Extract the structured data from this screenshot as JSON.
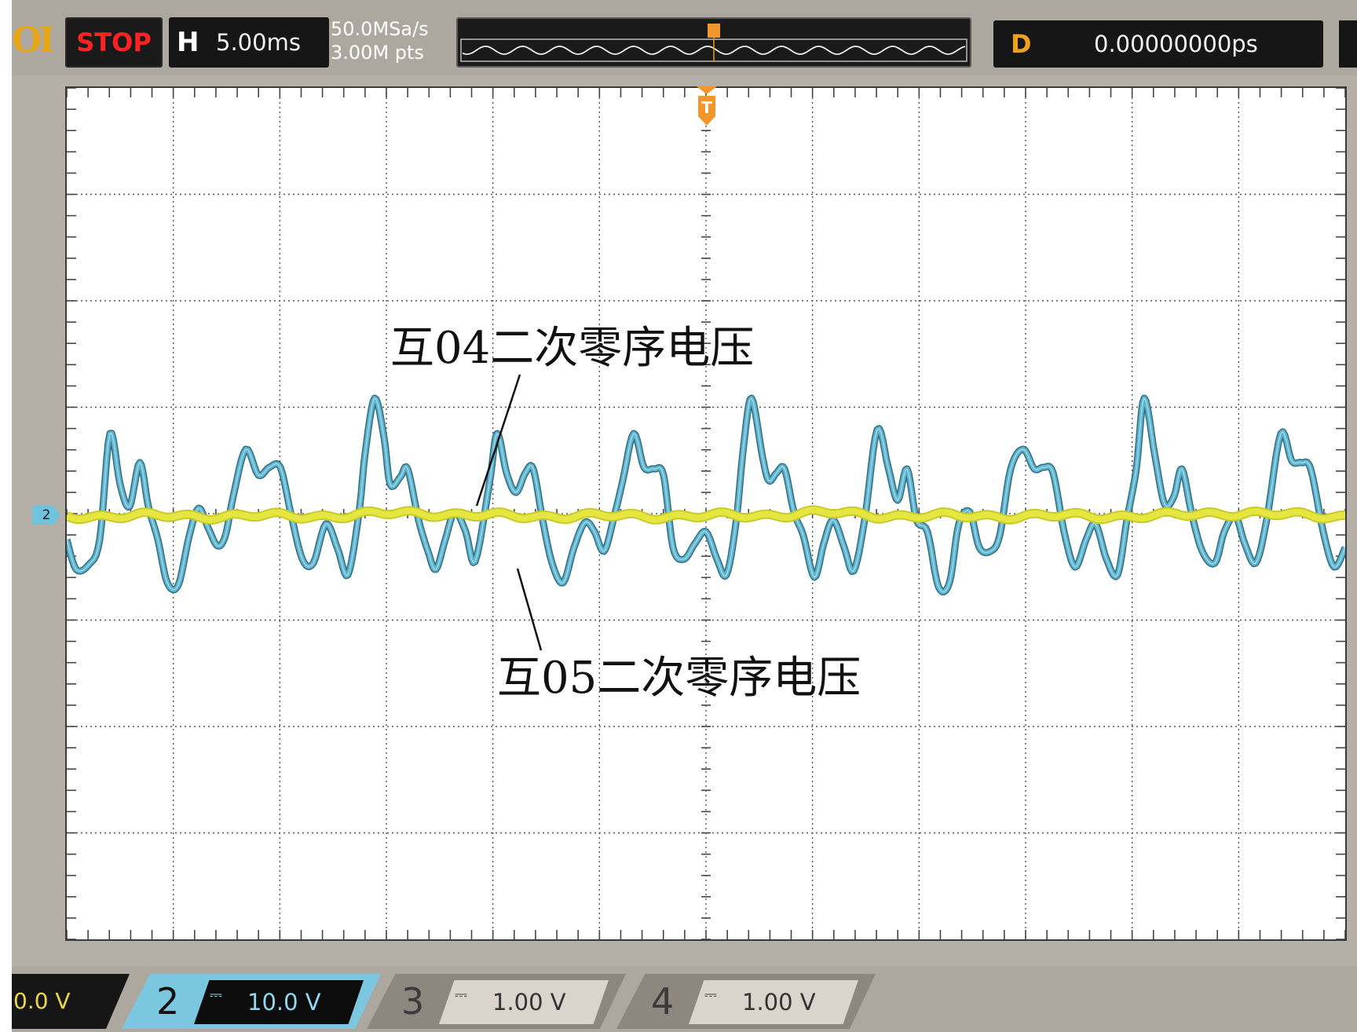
{
  "status": {
    "brand_fragment": "OL",
    "run_state": "STOP"
  },
  "horizontal": {
    "key": "H",
    "time_per_div": "5.00ms",
    "sample_rate": "50.0MSa/s",
    "memory_depth": "3.00M pts"
  },
  "delay": {
    "key": "D",
    "value": "0.00000000ps"
  },
  "trigger": {
    "marker": "T"
  },
  "annotations": {
    "ch_04": "互04二次零序电压",
    "ch_05": "互05二次零序电压"
  },
  "channels": {
    "ch1": {
      "scale": "0.0 V",
      "color": "#e8d84a"
    },
    "ch2": {
      "number": "2",
      "coupling": "⎓",
      "scale": "10.0 V",
      "color": "#6fc3dd"
    },
    "ch3": {
      "number": "3",
      "coupling": "⎓",
      "scale": "1.00 V"
    },
    "ch4": {
      "number": "4",
      "coupling": "⎓",
      "scale": "1.00 V"
    },
    "ch2_marker": "2"
  },
  "colors": {
    "trace_ch2": "#5fb3cc",
    "trace_ch1": "#e6e640",
    "screen_bg": "#ffffff",
    "bezel": "#b5b0a7"
  }
}
